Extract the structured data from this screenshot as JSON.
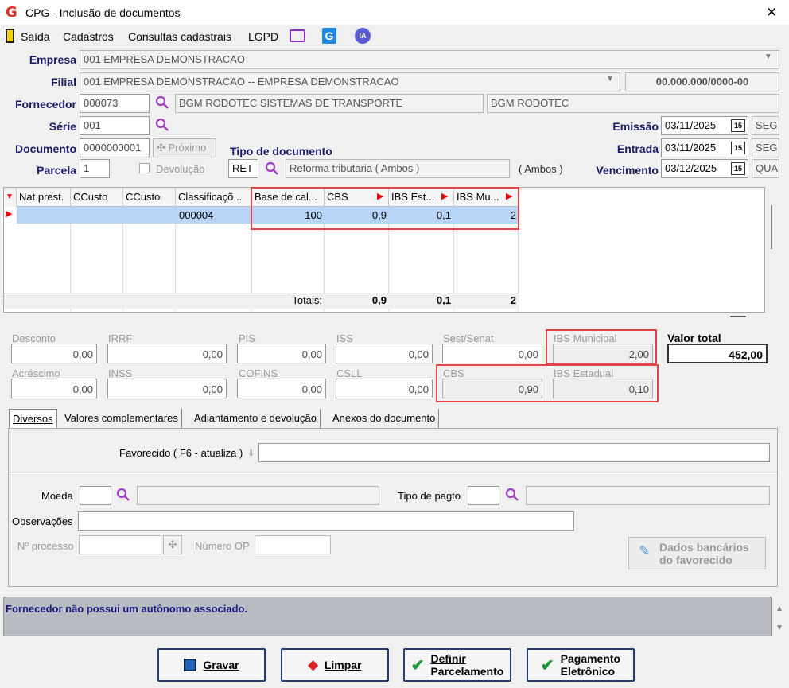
{
  "window": {
    "title": "CPG - Inclusão de documentos"
  },
  "menu": [
    "Saída",
    "Cadastros",
    "Consultas cadastrais",
    "LGPD"
  ],
  "menu_badge": "IA",
  "labels": {
    "empresa": "Empresa",
    "filial": "Filial",
    "fornecedor": "Fornecedor",
    "serie": "Série",
    "documento": "Documento",
    "parcela": "Parcela",
    "tipo_doc": "Tipo de documento",
    "emissao": "Emissão",
    "entrada": "Entrada",
    "vencimento": "Vencimento",
    "devolucao": "Devolução",
    "proximo": "Próximo"
  },
  "fields": {
    "empresa": "001 EMPRESA DEMONSTRACAO",
    "filial": "001 EMPRESA DEMONSTRACAO -- EMPRESA DEMONSTRACAO",
    "cnpj": "00.000.000/0000-00",
    "fornecedor_code": "000073",
    "fornecedor_name": "BGM RODOTEC SISTEMAS DE TRANSPORTE",
    "fornecedor_short": "BGM RODOTEC",
    "serie": "001",
    "documento": "0000000001",
    "parcela": "1",
    "tipo_code": "RET",
    "tipo_desc": "Reforma tributaria ( Ambos )",
    "tipo_extra": "( Ambos )",
    "emissao": "03/11/2025",
    "emissao_dow": "SEG",
    "entrada": "03/11/2025",
    "entrada_dow": "SEG",
    "vencimento": "03/12/2025",
    "vencimento_dow": "QUA",
    "cal_icon": "15"
  },
  "grid": {
    "headers": [
      "Nat.prest.",
      "CCusto",
      "CCusto",
      "Classificaçõ...",
      "Base de cal...",
      "CBS",
      "IBS Est...",
      "IBS Mu..."
    ],
    "row": {
      "classificacao": "000004",
      "base": "100",
      "cbs": "0,9",
      "ibs_est": "0,1",
      "ibs_mun": "2"
    },
    "totals_label": "Totais:",
    "totals": {
      "cbs": "0,9",
      "ibs_est": "0,1",
      "ibs_mun": "2"
    }
  },
  "taxes": {
    "desconto": {
      "label": "Desconto",
      "value": "0,00"
    },
    "irrf": {
      "label": "IRRF",
      "value": "0,00"
    },
    "pis": {
      "label": "PIS",
      "value": "0,00"
    },
    "iss": {
      "label": "ISS",
      "value": "0,00"
    },
    "sest": {
      "label": "Sest/Senat",
      "value": "0,00"
    },
    "ibs_mun": {
      "label": "IBS Municipal",
      "value": "2,00"
    },
    "acrescimo": {
      "label": "Acréscimo",
      "value": "0,00"
    },
    "inss": {
      "label": "INSS",
      "value": "0,00"
    },
    "cofins": {
      "label": "COFINS",
      "value": "0,00"
    },
    "csll": {
      "label": "CSLL",
      "value": "0,00"
    },
    "cbs": {
      "label": "CBS",
      "value": "0,90"
    },
    "ibs_est": {
      "label": "IBS Estadual",
      "value": "0,10"
    },
    "valor_total": {
      "label": "Valor total",
      "value": "452,00"
    }
  },
  "tabs": [
    "Diversos",
    "Valores complementares",
    "Adiantamento e devolução",
    "Anexos do documento"
  ],
  "diversos": {
    "favorecido": "Favorecido ( F6 - atualiza )",
    "moeda": "Moeda",
    "tipo_pagto": "Tipo de pagto",
    "observacoes": "Observações",
    "nprocesso": "Nº processo",
    "numero_op": "Número OP",
    "dados_bancarios_1": "Dados bancários",
    "dados_bancarios_2": "do favorecido"
  },
  "status": "Fornecedor não possui um autônomo associado.",
  "buttons": {
    "gravar": "Gravar",
    "limpar": "Limpar",
    "definir_1": "Definir",
    "definir_2": "Parcelamento",
    "pagamento_1": "Pagamento",
    "pagamento_2": "Eletrônico"
  }
}
